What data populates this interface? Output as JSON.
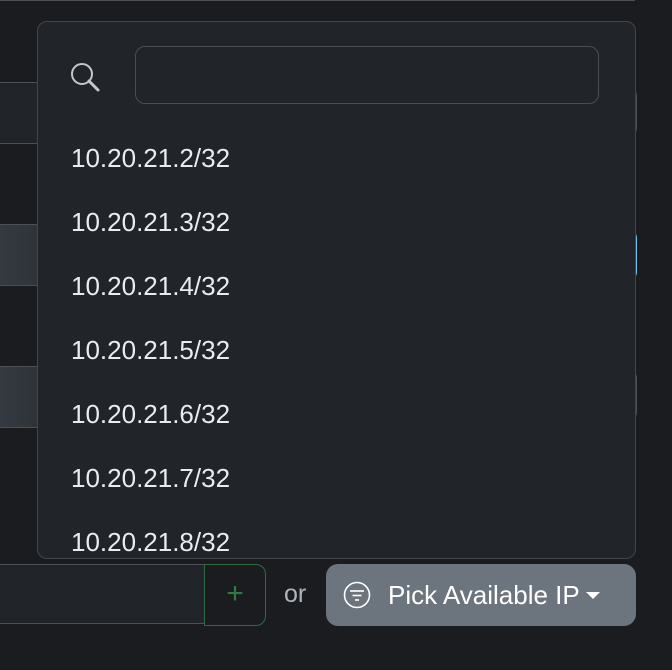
{
  "dropdown": {
    "search": {
      "value": "",
      "placeholder": ""
    },
    "options": [
      "10.20.21.2/32",
      "10.20.21.3/32",
      "10.20.21.4/32",
      "10.20.21.5/32",
      "10.20.21.6/32",
      "10.20.21.7/32",
      "10.20.21.8/32"
    ]
  },
  "footer": {
    "add_label": "+",
    "or_label": "or",
    "pick_label": "Pick Available IP"
  }
}
